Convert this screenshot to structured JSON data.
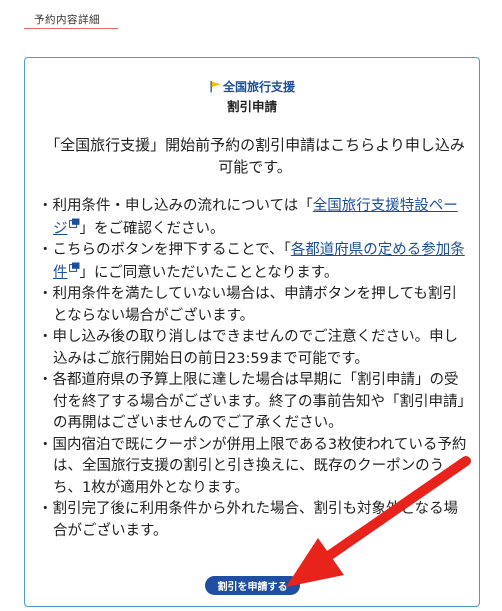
{
  "section": {
    "title": "予約内容詳細"
  },
  "card": {
    "brand": "全国旅行支援",
    "heading": "割引申請",
    "lead": "「全国旅行支援」開始前予約の割引申請はこちらより申し込み可能です。",
    "bullets": [
      {
        "pre": "・利用条件・申し込みの流れについては「",
        "link": "全国旅行支援特設ページ",
        "post": "」をご確認ください。"
      },
      {
        "pre": "・こちらのボタンを押下することで、「",
        "link": "各都道府県の定める参加条件",
        "post": "」にご同意いただいたこととなります。"
      },
      {
        "text": "・利用条件を満たしていない場合は、申請ボタンを押しても割引とならない場合がございます。"
      },
      {
        "text": "・申し込み後の取り消しはできませんのでご注意ください。申し込みはご旅行開始日の前日23:59まで可能です。"
      },
      {
        "text": "・各都道府県の予算上限に達した場合は早期に「割引申請」の受付を終了する場合がございます。終了の事前告知や「割引申請」の再開はございませんのでご了承ください。"
      },
      {
        "text": "・国内宿泊で既にクーポンが併用上限である3枚使われている予約は、全国旅行支援の割引と引き換えに、既存のクーポンのうち、1枚が適用外となります。"
      },
      {
        "text": "・割引完了後に利用条件から外れた場合、割引も対象外となる場合がございます。"
      }
    ],
    "button_label": "割引を申請する"
  },
  "colors": {
    "accent_blue": "#1f4fa3",
    "link_blue": "#1b4f9c",
    "card_border": "#4a9dd0",
    "underline_red": "#e96a6a",
    "arrow_red": "#e8231c",
    "flag_yellow": "#f2c300"
  },
  "icons": {
    "brand": "flag-icon",
    "external": "external-link-icon",
    "annotation": "red-arrow-annotation"
  }
}
